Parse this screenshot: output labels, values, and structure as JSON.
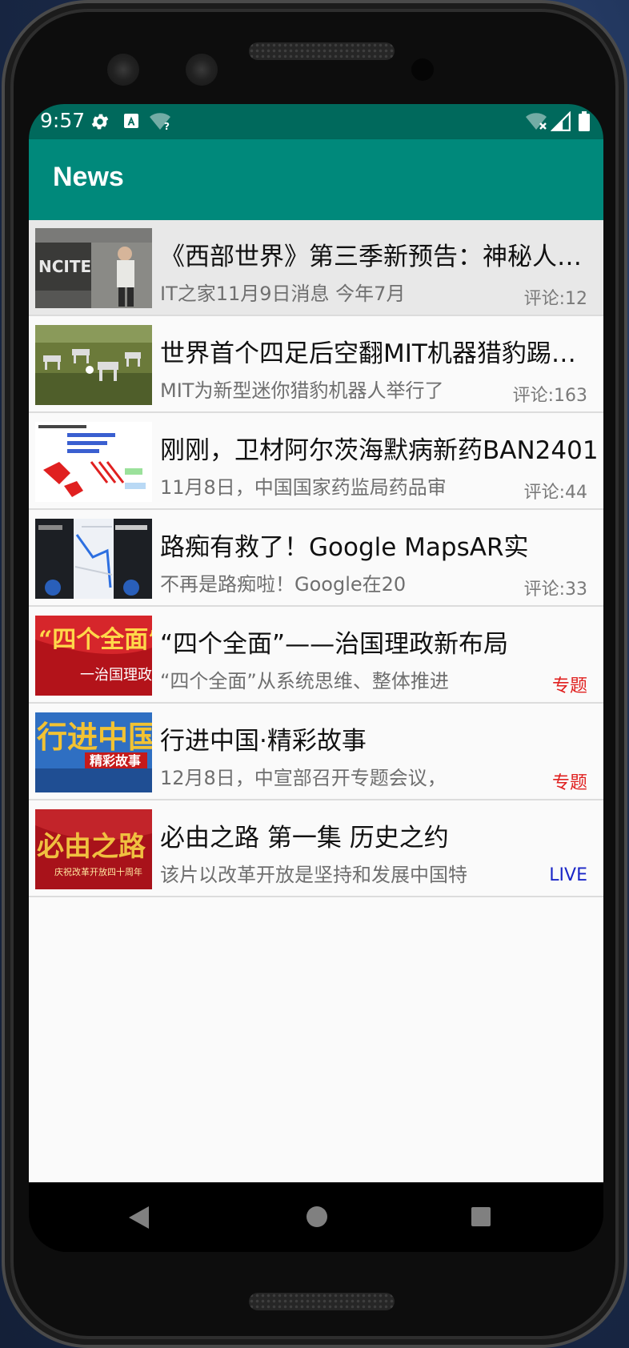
{
  "status_bar": {
    "time": "9:57",
    "icons_left": [
      "gear-icon",
      "a-notification-icon",
      "wifi-question-icon"
    ],
    "icons_right": [
      "wifi-off-icon",
      "signal-icon",
      "battery-icon"
    ]
  },
  "app_bar": {
    "title": "News",
    "background": "#00897b",
    "status_bar_color": "#00695c"
  },
  "news": [
    {
      "title": "《西部世界》第三季新预告：神秘人物登场",
      "desc": "IT之家11月9日消息 今年7月",
      "meta": "评论:12",
      "meta_type": "comments",
      "selected": true
    },
    {
      "title": "世界首个四足后空翻MIT机器猎豹踢足球",
      "desc": "MIT为新型迷你猎豹机器人举行了",
      "meta": "评论:163",
      "meta_type": "comments",
      "selected": false
    },
    {
      "title": "刚刚，卫材阿尔茨海默病新药BAN2401",
      "desc": "11月8日，中国国家药监局药品审",
      "meta": "评论:44",
      "meta_type": "comments",
      "selected": false
    },
    {
      "title": "路痴有救了！Google MapsAR实",
      "desc": "不再是路痴啦！Google在20",
      "meta": "评论:33",
      "meta_type": "comments",
      "selected": false
    },
    {
      "title": "“四个全面”——治国理政新布局",
      "desc": "“四个全面”从系统思维、整体推进",
      "meta": "专题",
      "meta_type": "tag",
      "selected": false
    },
    {
      "title": "行进中国·精彩故事",
      "desc": "12月8日，中宣部召开专题会议，",
      "meta": "专题",
      "meta_type": "tag",
      "selected": false
    },
    {
      "title": "必由之路 第一集 历史之约",
      "desc": "该片以改革开放是坚持和发展中国特",
      "meta": "LIVE",
      "meta_type": "live",
      "selected": false
    }
  ],
  "thumbnails": {
    "1": {
      "text": "NCITE"
    },
    "5": {
      "big": "“四个全面”",
      "small": "一治国理政"
    },
    "6": {
      "big": "行进中国",
      "badge": "精彩故事"
    },
    "7": {
      "big": "必由之路",
      "small": "庆祝改革开放四十周年"
    }
  },
  "colors": {
    "tag": "#e0201f",
    "live": "#1a26c7",
    "comments": "#7a7a7a"
  },
  "nav": [
    "back-icon",
    "home-icon",
    "recents-icon"
  ]
}
